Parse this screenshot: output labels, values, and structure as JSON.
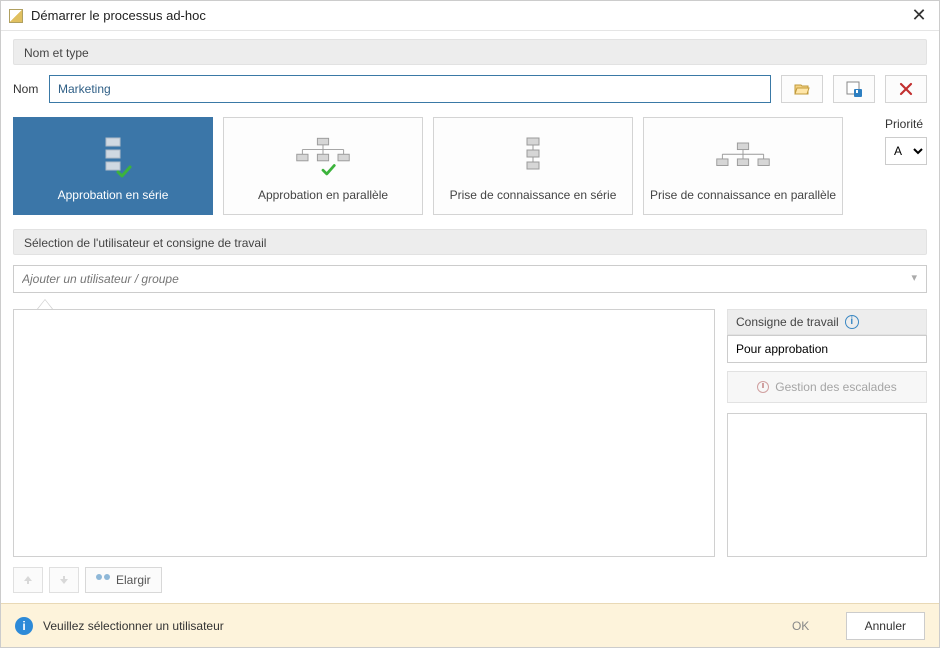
{
  "titlebar": {
    "title": "Démarrer le processus ad-hoc"
  },
  "sections": {
    "name_type": "Nom et type",
    "user_selection": "Sélection de l'utilisateur et consigne de travail",
    "instruction": "Consigne de travail"
  },
  "name": {
    "label": "Nom",
    "value": "Marketing"
  },
  "cards": {
    "serial_approval": "Approbation en série",
    "parallel_approval": "Approbation en parallèle",
    "serial_notice": "Prise de connaissance en série",
    "parallel_notice": "Prise de connaissance en parallèle"
  },
  "priority": {
    "label": "Priorité",
    "value": "A"
  },
  "add_user": {
    "placeholder": "Ajouter un utilisateur / groupe"
  },
  "instruction_value": "Pour approbation",
  "escalation_label": "Gestion des escalades",
  "expand_label": "Elargir",
  "footer": {
    "message": "Veuillez sélectionner un utilisateur",
    "ok": "OK",
    "cancel": "Annuler"
  }
}
